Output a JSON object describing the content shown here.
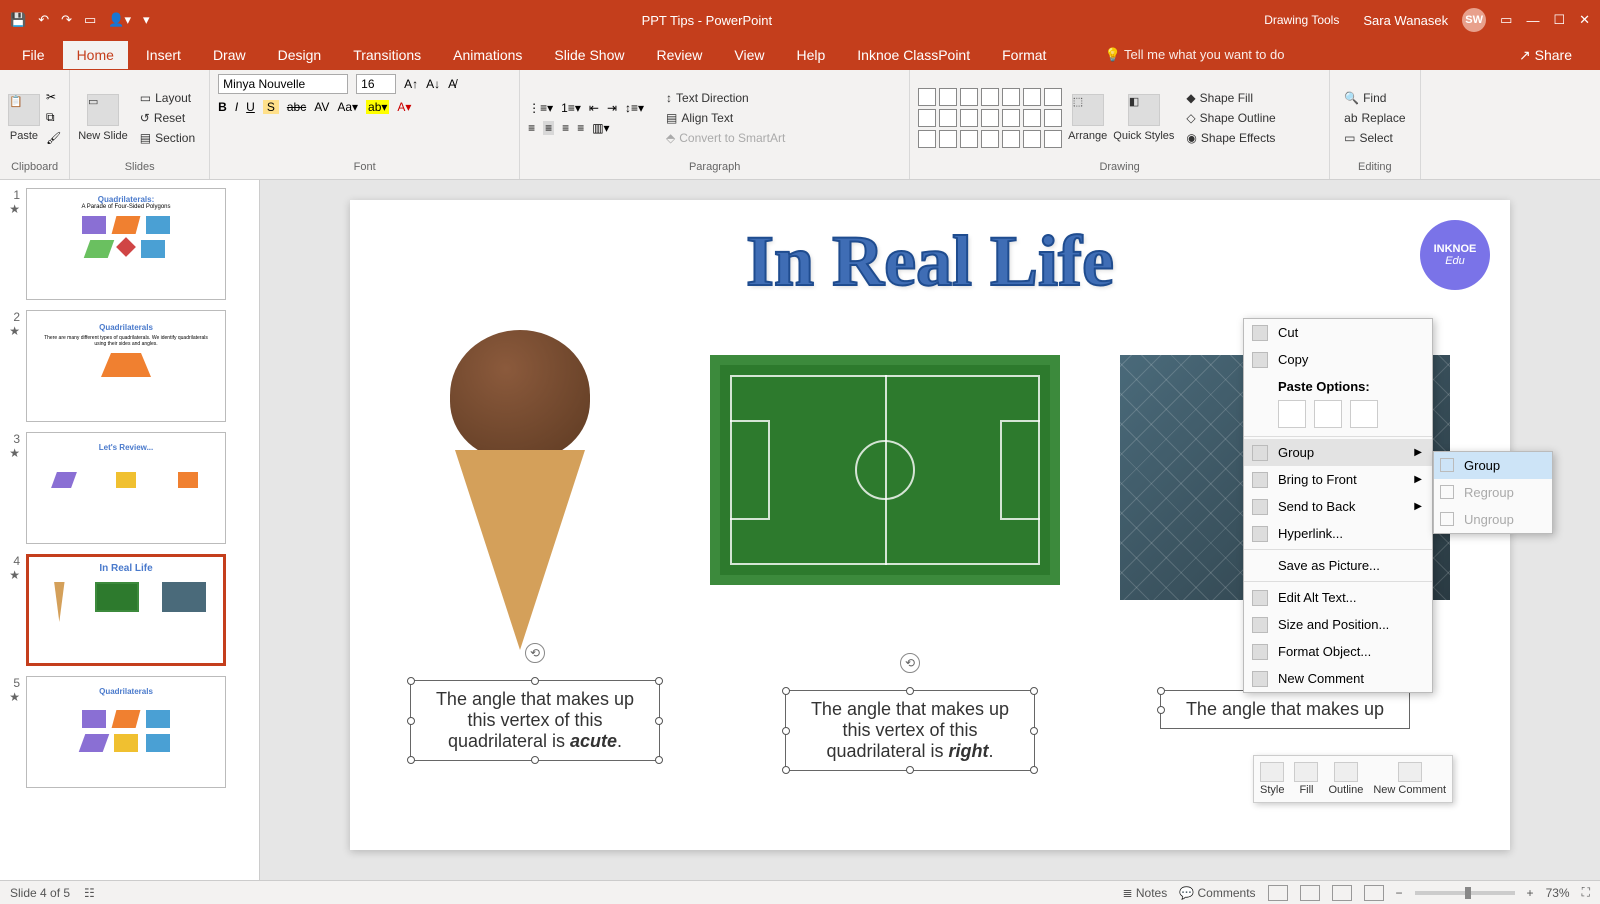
{
  "titlebar": {
    "doc_title": "PPT Tips - PowerPoint",
    "drawing_tools": "Drawing Tools",
    "user_name": "Sara Wanasek",
    "user_initials": "SW"
  },
  "tabs": {
    "file": "File",
    "home": "Home",
    "insert": "Insert",
    "draw": "Draw",
    "design": "Design",
    "transitions": "Transitions",
    "animations": "Animations",
    "slideshow": "Slide Show",
    "review": "Review",
    "view": "View",
    "help": "Help",
    "classpoint": "Inknoe ClassPoint",
    "format": "Format",
    "tellme": "Tell me what you want to do",
    "share": "Share"
  },
  "ribbon": {
    "paste": "Paste",
    "new_slide": "New Slide",
    "layout": "Layout",
    "reset": "Reset",
    "section": "Section",
    "font_name": "Minya Nouvelle",
    "font_size": "16",
    "text_direction": "Text Direction",
    "align_text": "Align Text",
    "convert_smart": "Convert to SmartArt",
    "arrange": "Arrange",
    "quick_styles": "Quick Styles",
    "shape_fill": "Shape Fill",
    "shape_outline": "Shape Outline",
    "shape_effects": "Shape Effects",
    "find": "Find",
    "replace": "Replace",
    "select": "Select",
    "g_clipboard": "Clipboard",
    "g_slides": "Slides",
    "g_font": "Font",
    "g_paragraph": "Paragraph",
    "g_drawing": "Drawing",
    "g_editing": "Editing"
  },
  "thumbs": {
    "t1_title": "Quadrilaterals:",
    "t1_sub": "A Parade of Four-Sided Polygons",
    "t2_title": "Quadrilaterals",
    "t3_title": "Let's Review...",
    "t4_title": "In Real Life",
    "t5_title": "Quadrilaterals"
  },
  "slide": {
    "title": "In Real Life",
    "badge_top": "INKNOE",
    "badge_bot": "Edu",
    "tb1_a": "The angle that makes up",
    "tb1_b": "this vertex of this",
    "tb1_c_pre": "quadrilateral  is ",
    "tb1_c_em": "acute",
    "tb1_c_post": ".",
    "tb2_a": "The angle that makes up",
    "tb2_b": "this vertex of this",
    "tb2_c_pre": "quadrilateral  is ",
    "tb2_c_em": "right",
    "tb2_c_post": ".",
    "tb3_a": "The angle that makes up"
  },
  "ctx": {
    "cut": "Cut",
    "copy": "Copy",
    "paste_header": "Paste Options:",
    "group": "Group",
    "bring_front": "Bring to Front",
    "send_back": "Send to Back",
    "hyperlink": "Hyperlink...",
    "save_pic": "Save as Picture...",
    "alt_text": "Edit Alt Text...",
    "size_pos": "Size and Position...",
    "format_obj": "Format Object...",
    "new_comment": "New Comment"
  },
  "submenu": {
    "group": "Group",
    "regroup": "Regroup",
    "ungroup": "Ungroup"
  },
  "minibar": {
    "style": "Style",
    "fill": "Fill",
    "outline": "Outline",
    "new_comment": "New Comment"
  },
  "status": {
    "slide_of": "Slide 4 of 5",
    "notes": "Notes",
    "comments": "Comments",
    "zoom": "73%"
  }
}
